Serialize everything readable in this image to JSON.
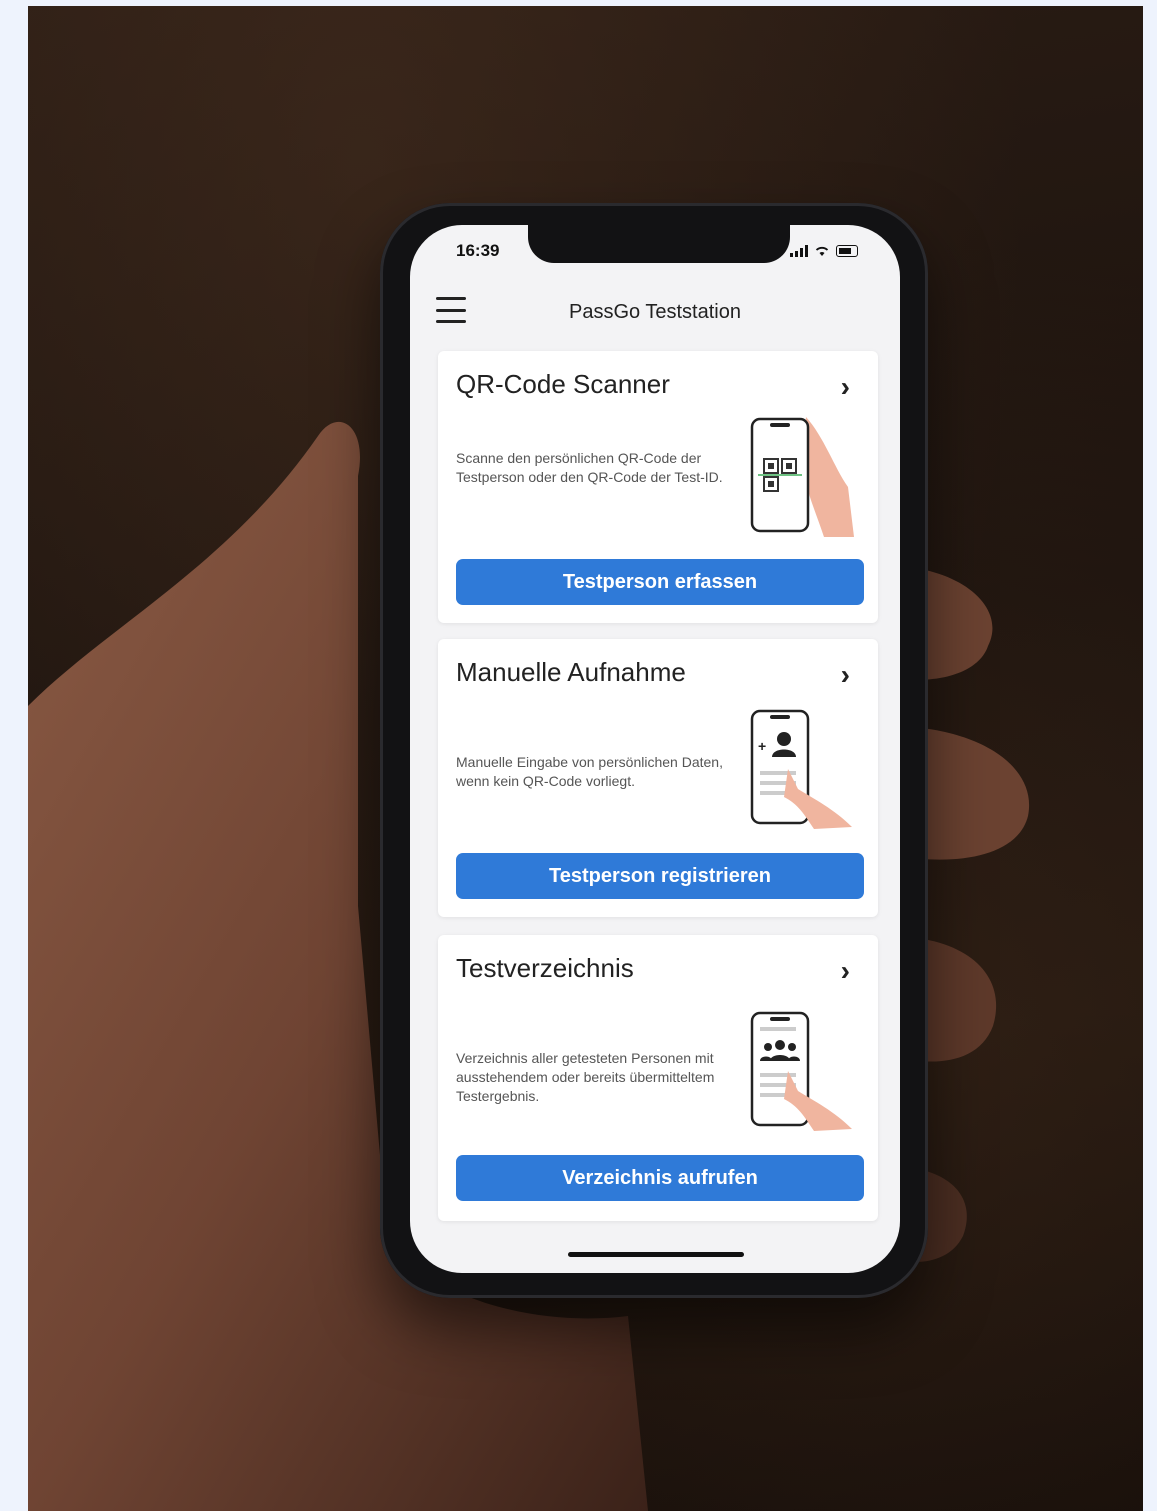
{
  "status": {
    "time": "16:39"
  },
  "header": {
    "title": "PassGo Teststation"
  },
  "cards": [
    {
      "title": "QR-Code Scanner",
      "description": "Scanne den persönlichen QR-Code der Testperson oder den QR-Code der Test-ID.",
      "button": "Testperson erfassen",
      "illustration": "qr-scan-icon"
    },
    {
      "title": "Manuelle Aufnahme",
      "description": "Manuelle Eingabe von persönlichen Daten, wenn kein QR-Code vorliegt.",
      "button": "Testperson registrieren",
      "illustration": "add-person-icon"
    },
    {
      "title": "Testverzeichnis",
      "description": "Verzeichnis aller getesteten Personen mit ausstehendem oder bereits übermitteltem Testergebnis.",
      "button": "Verzeichnis aufrufen",
      "illustration": "people-list-icon"
    }
  ],
  "colors": {
    "accent": "#2f7ad8",
    "frame": "#eef3fd",
    "phone": "#121214"
  }
}
